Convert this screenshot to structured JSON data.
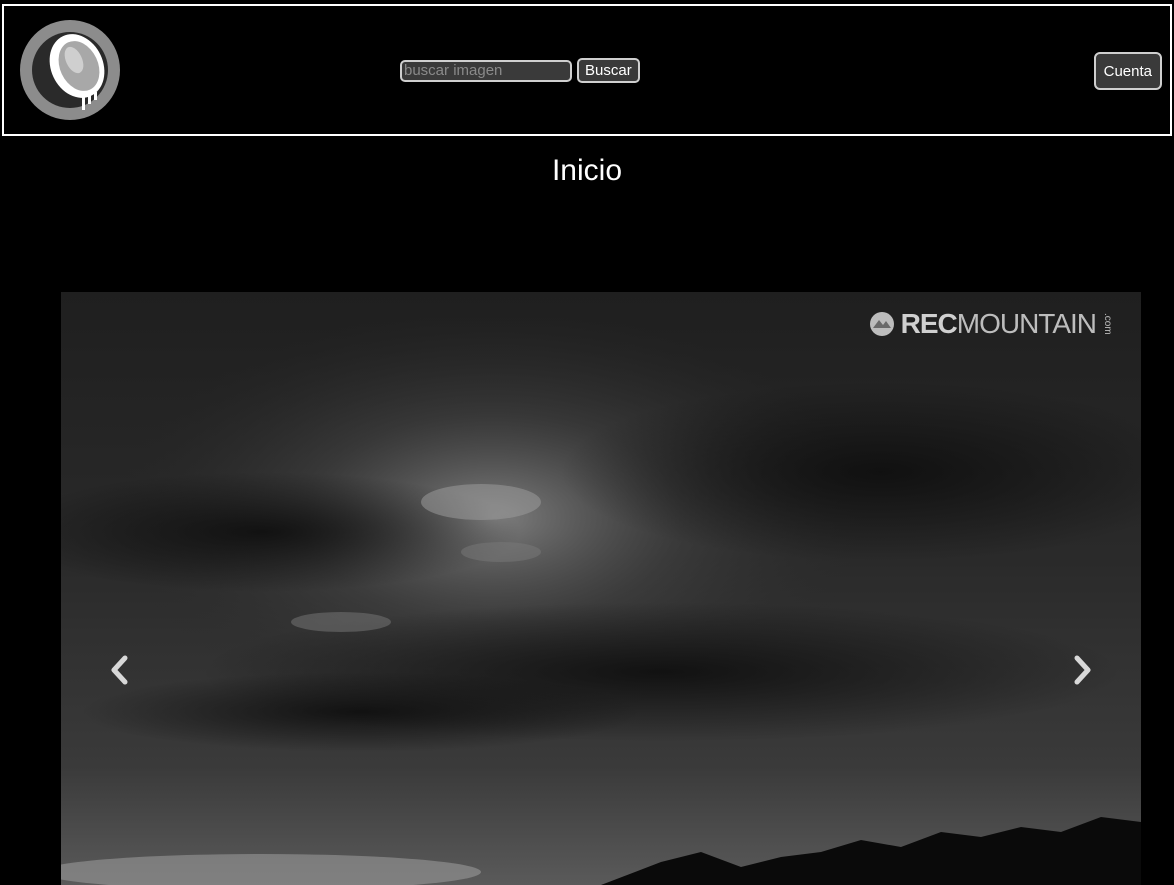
{
  "header": {
    "logo_icon": "coconut-logo-icon",
    "search": {
      "placeholder": "buscar imagen",
      "value": "",
      "button_label": "Buscar"
    },
    "account_label": "Cuenta"
  },
  "main": {
    "title": "Inicio",
    "carousel": {
      "watermark": {
        "brand_bold": "REC",
        "brand_light": "MOUNTAIN",
        "suffix": ".com"
      },
      "prev_icon": "chevron-left-icon",
      "next_icon": "chevron-right-icon"
    }
  },
  "colors": {
    "background": "#000000",
    "border": "#ffffff",
    "button_bg": "#3a3a3a"
  }
}
